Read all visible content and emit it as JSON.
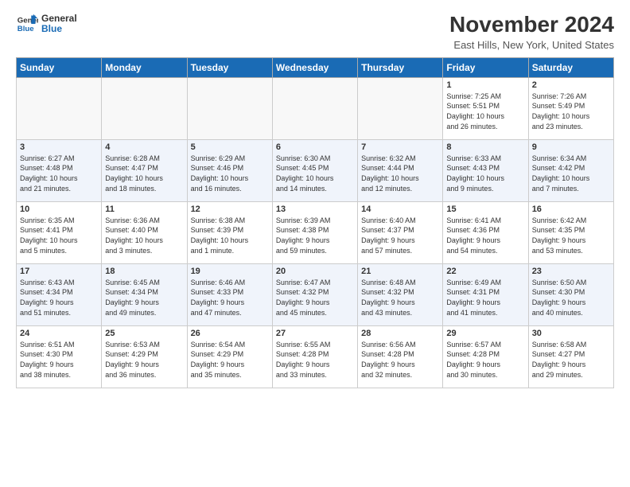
{
  "header": {
    "logo_line1": "General",
    "logo_line2": "Blue",
    "title": "November 2024",
    "location": "East Hills, New York, United States"
  },
  "weekdays": [
    "Sunday",
    "Monday",
    "Tuesday",
    "Wednesday",
    "Thursday",
    "Friday",
    "Saturday"
  ],
  "weeks": [
    [
      {
        "day": "",
        "info": ""
      },
      {
        "day": "",
        "info": ""
      },
      {
        "day": "",
        "info": ""
      },
      {
        "day": "",
        "info": ""
      },
      {
        "day": "",
        "info": ""
      },
      {
        "day": "1",
        "info": "Sunrise: 7:25 AM\nSunset: 5:51 PM\nDaylight: 10 hours\nand 26 minutes."
      },
      {
        "day": "2",
        "info": "Sunrise: 7:26 AM\nSunset: 5:49 PM\nDaylight: 10 hours\nand 23 minutes."
      }
    ],
    [
      {
        "day": "3",
        "info": "Sunrise: 6:27 AM\nSunset: 4:48 PM\nDaylight: 10 hours\nand 21 minutes."
      },
      {
        "day": "4",
        "info": "Sunrise: 6:28 AM\nSunset: 4:47 PM\nDaylight: 10 hours\nand 18 minutes."
      },
      {
        "day": "5",
        "info": "Sunrise: 6:29 AM\nSunset: 4:46 PM\nDaylight: 10 hours\nand 16 minutes."
      },
      {
        "day": "6",
        "info": "Sunrise: 6:30 AM\nSunset: 4:45 PM\nDaylight: 10 hours\nand 14 minutes."
      },
      {
        "day": "7",
        "info": "Sunrise: 6:32 AM\nSunset: 4:44 PM\nDaylight: 10 hours\nand 12 minutes."
      },
      {
        "day": "8",
        "info": "Sunrise: 6:33 AM\nSunset: 4:43 PM\nDaylight: 10 hours\nand 9 minutes."
      },
      {
        "day": "9",
        "info": "Sunrise: 6:34 AM\nSunset: 4:42 PM\nDaylight: 10 hours\nand 7 minutes."
      }
    ],
    [
      {
        "day": "10",
        "info": "Sunrise: 6:35 AM\nSunset: 4:41 PM\nDaylight: 10 hours\nand 5 minutes."
      },
      {
        "day": "11",
        "info": "Sunrise: 6:36 AM\nSunset: 4:40 PM\nDaylight: 10 hours\nand 3 minutes."
      },
      {
        "day": "12",
        "info": "Sunrise: 6:38 AM\nSunset: 4:39 PM\nDaylight: 10 hours\nand 1 minute."
      },
      {
        "day": "13",
        "info": "Sunrise: 6:39 AM\nSunset: 4:38 PM\nDaylight: 9 hours\nand 59 minutes."
      },
      {
        "day": "14",
        "info": "Sunrise: 6:40 AM\nSunset: 4:37 PM\nDaylight: 9 hours\nand 57 minutes."
      },
      {
        "day": "15",
        "info": "Sunrise: 6:41 AM\nSunset: 4:36 PM\nDaylight: 9 hours\nand 54 minutes."
      },
      {
        "day": "16",
        "info": "Sunrise: 6:42 AM\nSunset: 4:35 PM\nDaylight: 9 hours\nand 53 minutes."
      }
    ],
    [
      {
        "day": "17",
        "info": "Sunrise: 6:43 AM\nSunset: 4:34 PM\nDaylight: 9 hours\nand 51 minutes."
      },
      {
        "day": "18",
        "info": "Sunrise: 6:45 AM\nSunset: 4:34 PM\nDaylight: 9 hours\nand 49 minutes."
      },
      {
        "day": "19",
        "info": "Sunrise: 6:46 AM\nSunset: 4:33 PM\nDaylight: 9 hours\nand 47 minutes."
      },
      {
        "day": "20",
        "info": "Sunrise: 6:47 AM\nSunset: 4:32 PM\nDaylight: 9 hours\nand 45 minutes."
      },
      {
        "day": "21",
        "info": "Sunrise: 6:48 AM\nSunset: 4:32 PM\nDaylight: 9 hours\nand 43 minutes."
      },
      {
        "day": "22",
        "info": "Sunrise: 6:49 AM\nSunset: 4:31 PM\nDaylight: 9 hours\nand 41 minutes."
      },
      {
        "day": "23",
        "info": "Sunrise: 6:50 AM\nSunset: 4:30 PM\nDaylight: 9 hours\nand 40 minutes."
      }
    ],
    [
      {
        "day": "24",
        "info": "Sunrise: 6:51 AM\nSunset: 4:30 PM\nDaylight: 9 hours\nand 38 minutes."
      },
      {
        "day": "25",
        "info": "Sunrise: 6:53 AM\nSunset: 4:29 PM\nDaylight: 9 hours\nand 36 minutes."
      },
      {
        "day": "26",
        "info": "Sunrise: 6:54 AM\nSunset: 4:29 PM\nDaylight: 9 hours\nand 35 minutes."
      },
      {
        "day": "27",
        "info": "Sunrise: 6:55 AM\nSunset: 4:28 PM\nDaylight: 9 hours\nand 33 minutes."
      },
      {
        "day": "28",
        "info": "Sunrise: 6:56 AM\nSunset: 4:28 PM\nDaylight: 9 hours\nand 32 minutes."
      },
      {
        "day": "29",
        "info": "Sunrise: 6:57 AM\nSunset: 4:28 PM\nDaylight: 9 hours\nand 30 minutes."
      },
      {
        "day": "30",
        "info": "Sunrise: 6:58 AM\nSunset: 4:27 PM\nDaylight: 9 hours\nand 29 minutes."
      }
    ]
  ]
}
